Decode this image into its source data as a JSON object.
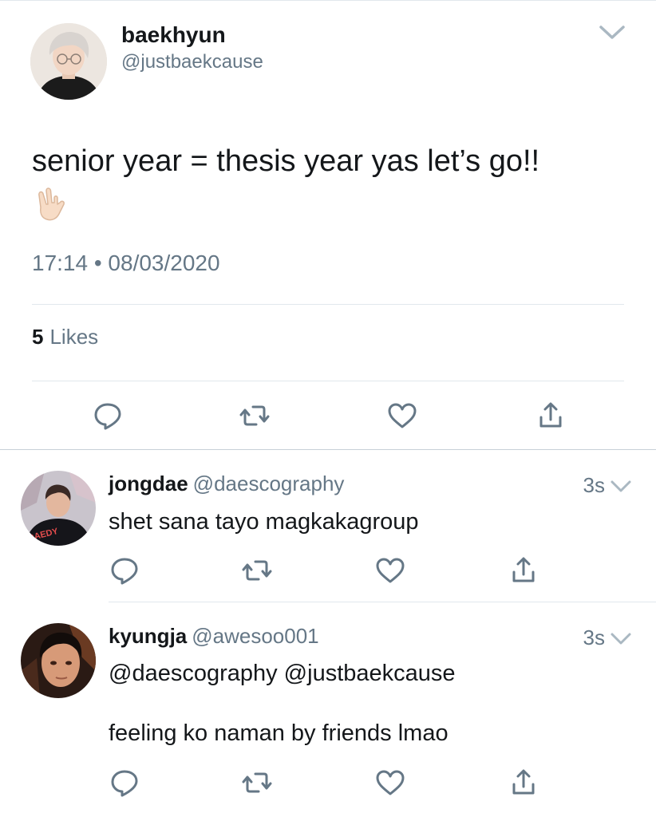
{
  "tweet": {
    "display_name": "baekhyun",
    "handle": "@justbaekcause",
    "text": "senior year = thesis year yas let’s go!!",
    "emoji": "🤟🏻",
    "timestamp": "17:14 • 08/03/2020",
    "likes_count": "5",
    "likes_label": "Likes"
  },
  "replies": [
    {
      "display_name": "jongdae",
      "handle": "@daescography",
      "age": "3s",
      "text": "shet sana tayo magkakagroup",
      "avatar_text": "DAEDY"
    },
    {
      "display_name": "kyungja",
      "handle": "@awesoo001",
      "age": "3s",
      "mentions": "@daescography @justbaekcause",
      "text": "feeling ko naman by friends lmao"
    }
  ],
  "icons": [
    "chevron-down-icon",
    "reply-icon",
    "retweet-icon",
    "like-icon",
    "share-icon"
  ],
  "colors": {
    "text": "#14171a",
    "secondary": "#657786",
    "mention": "#1da1f2",
    "divider": "#e1e8ed"
  }
}
